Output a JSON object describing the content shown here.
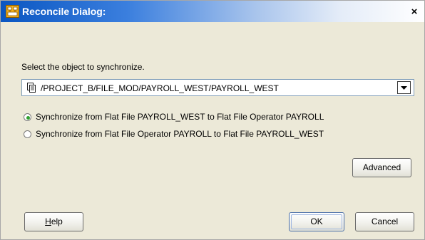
{
  "dialog": {
    "title": "Reconcile Dialog:",
    "close_glyph": "×",
    "title_icon": "warehouse-builder-icon"
  },
  "main": {
    "prompt": "Select the object to synchronize.",
    "object_path": {
      "icon": "document-copy-icon",
      "value": "/PROJECT_B/FILE_MOD/PAYROLL_WEST/PAYROLL_WEST"
    },
    "options": [
      {
        "label": "Synchronize from Flat File PAYROLL_WEST to Flat File Operator PAYROLL",
        "selected": true
      },
      {
        "label": "Synchronize from Flat File Operator PAYROLL to Flat File PAYROLL_WEST",
        "selected": false
      }
    ],
    "advanced_label": "Advanced"
  },
  "footer": {
    "help_mnemonic": "H",
    "help_rest": "elp",
    "ok_label": "OK",
    "cancel_label": "Cancel"
  },
  "colors": {
    "titlebar_start": "#0a56c2",
    "radio_selected": "#2fa12f",
    "dialog_background": "#ece9d8"
  }
}
